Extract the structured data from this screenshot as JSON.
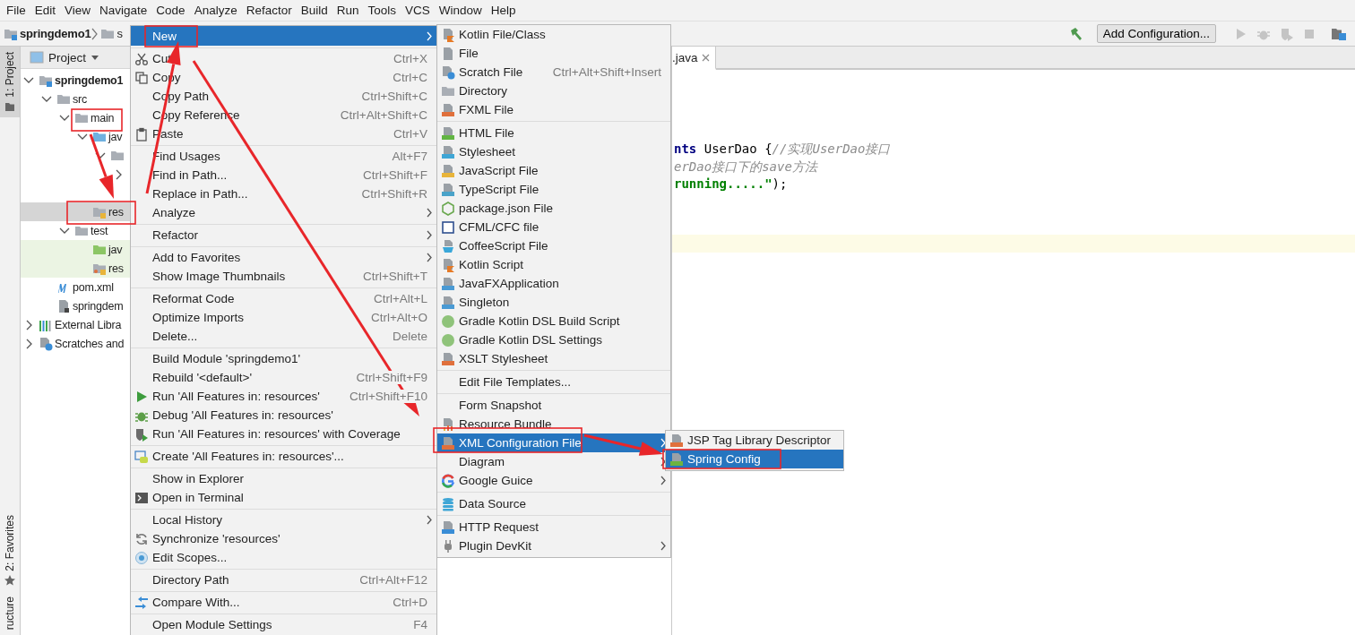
{
  "menu_bar": [
    "File",
    "Edit",
    "View",
    "Navigate",
    "Code",
    "Analyze",
    "Refactor",
    "Build",
    "Run",
    "Tools",
    "VCS",
    "Window",
    "Help"
  ],
  "breadcrumb": [
    {
      "label": "springdemo1"
    },
    {
      "label": "s"
    }
  ],
  "toolbar": {
    "configuration": "Add Configuration..."
  },
  "tool_windows": [
    {
      "label": "1: Project",
      "kind": "project",
      "selected": true
    },
    {
      "label": "2: Favorites",
      "kind": "favorites",
      "selected": false
    },
    {
      "label": "ructure",
      "kind": "structure",
      "selected": false
    }
  ],
  "project_panel": {
    "title": "Project",
    "tree": [
      {
        "label": "springdemo1",
        "kind": "module",
        "expanded": true,
        "selected": false,
        "children": [
          {
            "label": "src",
            "kind": "folder",
            "expanded": true,
            "selected": false,
            "children": [
              {
                "label": "main",
                "kind": "folder",
                "expanded": true,
                "selected": false,
                "children": [
                  {
                    "label": "jav",
                    "kind": "source",
                    "expanded": true,
                    "selected": false,
                    "children": [
                      {
                        "kind": "package",
                        "expanded": true,
                        "selected": false,
                        "children": [
                          {
                            "expanded": false,
                            "selected": false
                          },
                          {
                            "selected": false
                          }
                        ]
                      }
                    ]
                  },
                  {
                    "label": "res",
                    "kind": "resources",
                    "selected": true
                  }
                ]
              },
              {
                "label": "test",
                "kind": "folder",
                "expanded": true,
                "selected": false,
                "children": [
                  {
                    "label": "jav",
                    "kind": "test-source",
                    "selected": false
                  },
                  {
                    "label": "res",
                    "kind": "test-resources",
                    "selected": false
                  }
                ]
              }
            ]
          },
          {
            "label": "pom.xml",
            "kind": "maven",
            "selected": false
          },
          {
            "label": "springdem",
            "kind": "iml",
            "selected": false
          }
        ]
      },
      {
        "label": "External Libra",
        "kind": "libraries",
        "expanded": false,
        "selected": false
      },
      {
        "label": "Scratches and",
        "kind": "scratches",
        "expanded": false,
        "selected": false
      }
    ]
  },
  "editor": {
    "tabs": [
      {
        "label": ".java",
        "selected": true
      }
    ],
    "lines": [
      [
        {
          "kind": "keyword",
          "text": "nts"
        },
        {
          "kind": "plain",
          "text": " UserDao {"
        },
        {
          "kind": "comment",
          "text": "//实现UserDao接口"
        }
      ],
      [
        {
          "kind": "comment",
          "text": "erDao接口下的save方法"
        }
      ],
      [
        {
          "kind": "string",
          "text": "running.....\""
        },
        {
          "kind": "plain",
          "text": ");"
        }
      ]
    ]
  },
  "context_menu": {
    "groups": [
      [
        {
          "label": "New",
          "kind": "plain",
          "submenu": true,
          "selected": true
        }
      ],
      [
        {
          "label": "Cut",
          "kind": "cut",
          "shortcut": "Ctrl+X",
          "selected": false
        },
        {
          "label": "Copy",
          "kind": "copy",
          "shortcut": "Ctrl+C",
          "selected": false
        },
        {
          "label": "Copy Path",
          "kind": "plain",
          "shortcut": "Ctrl+Shift+C",
          "selected": false
        },
        {
          "label": "Copy Reference",
          "kind": "plain",
          "shortcut": "Ctrl+Alt+Shift+C",
          "selected": false
        },
        {
          "label": "Paste",
          "kind": "paste",
          "shortcut": "Ctrl+V",
          "selected": false
        }
      ],
      [
        {
          "label": "Find Usages",
          "kind": "plain",
          "shortcut": "Alt+F7",
          "selected": false
        },
        {
          "label": "Find in Path...",
          "kind": "plain",
          "shortcut": "Ctrl+Shift+F",
          "selected": false
        },
        {
          "label": "Replace in Path...",
          "kind": "plain",
          "shortcut": "Ctrl+Shift+R",
          "selected": false
        },
        {
          "label": "Analyze",
          "kind": "plain",
          "submenu": true,
          "selected": false
        }
      ],
      [
        {
          "label": "Refactor",
          "kind": "plain",
          "submenu": true,
          "selected": false
        }
      ],
      [
        {
          "label": "Add to Favorites",
          "kind": "plain",
          "submenu": true,
          "selected": false
        },
        {
          "label": "Show Image Thumbnails",
          "kind": "plain",
          "shortcut": "Ctrl+Shift+T",
          "selected": false
        }
      ],
      [
        {
          "label": "Reformat Code",
          "kind": "plain",
          "shortcut": "Ctrl+Alt+L",
          "selected": false
        },
        {
          "label": "Optimize Imports",
          "kind": "plain",
          "shortcut": "Ctrl+Alt+O",
          "selected": false
        },
        {
          "label": "Delete...",
          "kind": "plain",
          "shortcut": "Delete",
          "selected": false
        }
      ],
      [
        {
          "label": "Build Module 'springdemo1'",
          "kind": "plain",
          "selected": false
        },
        {
          "label": "Rebuild '<default>'",
          "kind": "plain",
          "shortcut": "Ctrl+Shift+F9",
          "selected": false
        },
        {
          "label": "Run 'All Features in: resources'",
          "kind": "run",
          "shortcut": "Ctrl+Shift+F10",
          "selected": false
        },
        {
          "label": "Debug 'All Features in: resources'",
          "kind": "debug",
          "selected": false
        },
        {
          "label": "Run 'All Features in: resources' with Coverage",
          "kind": "coverage",
          "selected": false
        }
      ],
      [
        {
          "label": "Create 'All Features in: resources'...",
          "kind": "create",
          "selected": false
        }
      ],
      [
        {
          "label": "Show in Explorer",
          "kind": "plain",
          "selected": false
        },
        {
          "label": "Open in Terminal",
          "kind": "terminal",
          "selected": false
        }
      ],
      [
        {
          "label": "Local History",
          "kind": "plain",
          "submenu": true,
          "selected": false
        },
        {
          "label": "Synchronize 'resources'",
          "kind": "sync",
          "selected": false
        },
        {
          "label": "Edit Scopes...",
          "kind": "scope",
          "selected": false
        }
      ],
      [
        {
          "label": "Directory Path",
          "kind": "plain",
          "shortcut": "Ctrl+Alt+F12",
          "selected": false
        }
      ],
      [
        {
          "label": "Compare With...",
          "kind": "compare",
          "shortcut": "Ctrl+D",
          "selected": false
        }
      ],
      [
        {
          "label": "Open Module Settings",
          "kind": "plain",
          "shortcut": "F4",
          "selected": false
        }
      ]
    ]
  },
  "new_submenu": {
    "groups": [
      [
        {
          "label": "Kotlin File/Class",
          "kind": "kotlin",
          "selected": false
        },
        {
          "label": "File",
          "kind": "file",
          "selected": false
        },
        {
          "label": "Scratch File",
          "kind": "scratch",
          "shortcut": "Ctrl+Alt+Shift+Insert",
          "selected": false
        },
        {
          "label": "Directory",
          "kind": "folder",
          "selected": false
        },
        {
          "label": "FXML File",
          "kind": "xml",
          "selected": false
        }
      ],
      [
        {
          "label": "HTML File",
          "kind": "html",
          "selected": false
        },
        {
          "label": "Stylesheet",
          "kind": "css",
          "selected": false
        },
        {
          "label": "JavaScript File",
          "kind": "js",
          "selected": false
        },
        {
          "label": "TypeScript File",
          "kind": "ts",
          "selected": false
        },
        {
          "label": "package.json File",
          "kind": "node",
          "selected": false
        },
        {
          "label": "CFML/CFC file",
          "kind": "cfml",
          "selected": false
        },
        {
          "label": "CoffeeScript File",
          "kind": "coffee",
          "selected": false
        },
        {
          "label": "Kotlin Script",
          "kind": "kotlin",
          "selected": false
        },
        {
          "label": "JavaFXApplication",
          "kind": "java",
          "selected": false
        },
        {
          "label": "Singleton",
          "kind": "java",
          "selected": false
        },
        {
          "label": "Gradle Kotlin DSL Build Script",
          "kind": "gradle",
          "selected": false
        },
        {
          "label": "Gradle Kotlin DSL Settings",
          "kind": "gradle",
          "selected": false
        },
        {
          "label": "XSLT Stylesheet",
          "kind": "xml",
          "selected": false
        }
      ],
      [
        {
          "label": "Edit File Templates...",
          "kind": "plain",
          "selected": false
        }
      ],
      [
        {
          "label": "Form Snapshot",
          "kind": "plain",
          "selected": false
        },
        {
          "label": "Resource Bundle",
          "kind": "bundle",
          "selected": false
        },
        {
          "label": "XML Configuration File",
          "kind": "xml",
          "submenu": true,
          "selected": true
        },
        {
          "label": "Diagram",
          "kind": "plain",
          "submenu": true,
          "selected": false
        },
        {
          "label": "Google Guice",
          "kind": "google",
          "submenu": true,
          "selected": false
        }
      ],
      [
        {
          "label": "Data Source",
          "kind": "database",
          "selected": false
        }
      ],
      [
        {
          "label": "HTTP Request",
          "kind": "api",
          "selected": false
        },
        {
          "label": "Plugin DevKit",
          "kind": "plugin",
          "submenu": true,
          "selected": false
        }
      ]
    ]
  },
  "xml_submenu": {
    "groups": [
      [
        {
          "label": "JSP Tag Library Descriptor",
          "kind": "xml",
          "selected": false
        },
        {
          "label": "Spring Config",
          "kind": "spring",
          "selected": true
        }
      ]
    ]
  }
}
